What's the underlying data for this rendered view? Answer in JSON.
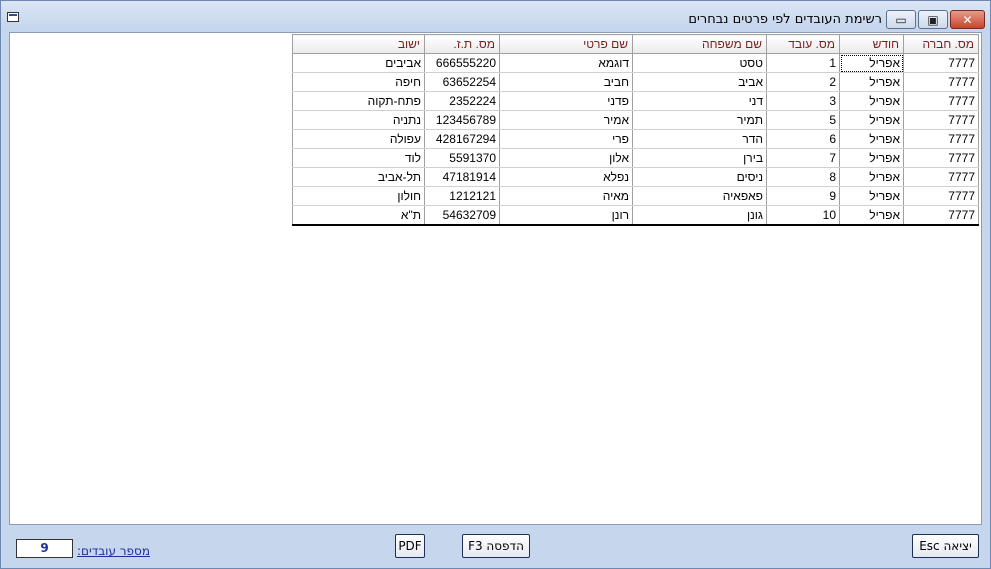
{
  "window": {
    "title": "רשימת העובדים לפי פרטים נבחרים"
  },
  "table": {
    "columns": [
      "מס. חברה",
      "חודש",
      "מס. עובד",
      "שם משפחה",
      "שם פרטי",
      "מס. ת.ז.",
      "ישוב"
    ],
    "rows": [
      [
        "7777",
        "אפריל",
        "1",
        "טסט",
        "דוגמא",
        "666555220",
        "אביבים"
      ],
      [
        "7777",
        "אפריל",
        "2",
        "אביב",
        "חביב",
        "63652254",
        "חיפה"
      ],
      [
        "7777",
        "אפריל",
        "3",
        "דני",
        "פדני",
        "2352224",
        "פתח-תקוה"
      ],
      [
        "7777",
        "אפריל",
        "5",
        "תמיר",
        "אמיר",
        "123456789",
        "נתניה"
      ],
      [
        "7777",
        "אפריל",
        "6",
        "הדר",
        "פרי",
        "428167294",
        "עפולה"
      ],
      [
        "7777",
        "אפריל",
        "7",
        "בירן",
        "אלון",
        "5591370",
        "לוד"
      ],
      [
        "7777",
        "אפריל",
        "8",
        "ניסים",
        "נפלא",
        "47181914",
        "תל-אביב"
      ],
      [
        "7777",
        "אפריל",
        "9",
        "פאפאיה",
        "מאיה",
        "1212121",
        "חולון"
      ],
      [
        "7777",
        "אפריל",
        "10",
        "גונן",
        "רונן",
        "54632709",
        "ת\"א"
      ]
    ]
  },
  "buttons": {
    "exit": "יציאה Esc",
    "print": "הדפסה F3",
    "pdf": "PDF"
  },
  "footer": {
    "count_label": "מספר עובדים:",
    "count_value": "9"
  },
  "icons": {
    "minimize": "minimize-icon",
    "maximize": "maximize-icon",
    "close": "close-icon"
  }
}
